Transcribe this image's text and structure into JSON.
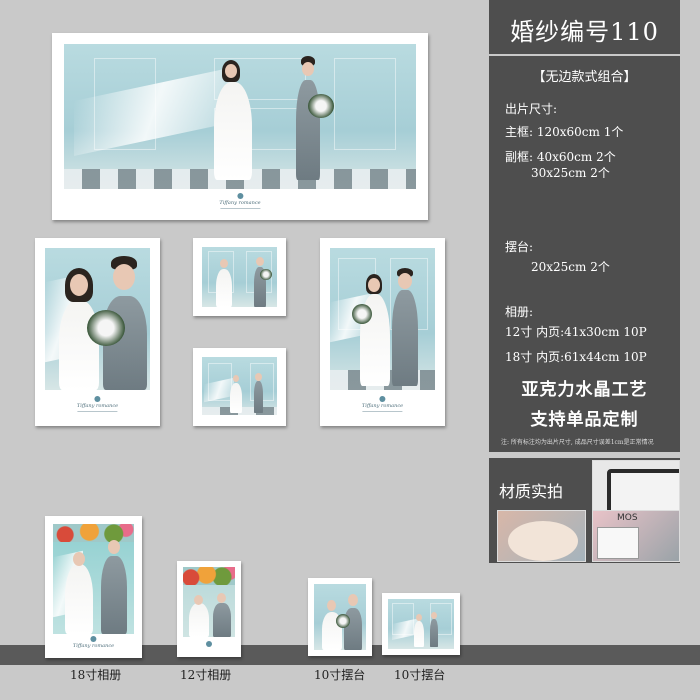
{
  "panel": {
    "title": "婚纱编号110",
    "subtitle": "【无边款式组合】",
    "size_label": "出片尺寸:",
    "main_frame": "主框: 120x60cm 1个",
    "sub_frame_1": "副框: 40x60cm 2个",
    "sub_frame_2": "30x25cm 2个",
    "stand_label": "摆台:",
    "stand_value": "20x25cm 2个",
    "album_label": "相册:",
    "album_12": "12寸  内页:41x30cm 10P",
    "album_18": "18寸  内页:61x44cm 10P",
    "craft": "亚克力水晶工艺",
    "custom": "支持单品定制",
    "note": "注: 所有标注均为出片尺寸, 成品尺寸误差1cm是正常情况"
  },
  "material": {
    "label": "材质实拍",
    "tile_text": "MOS"
  },
  "captions": {
    "album_18": "18寸相册",
    "album_12": "12寸相册",
    "stand_a": "10寸摆台",
    "stand_b": "10寸摆台"
  },
  "colors": {
    "panel_bg": "#4e4e4e",
    "page_bg": "#c9c9c9",
    "photo_wall": "#a6ced6"
  }
}
